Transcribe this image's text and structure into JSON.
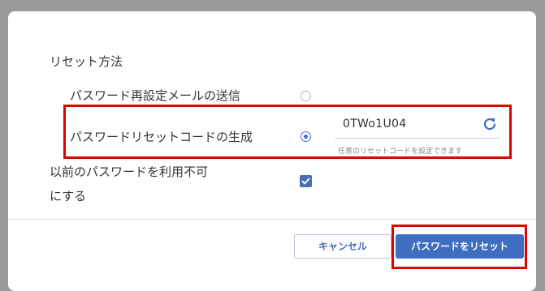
{
  "dialog": {
    "section_title": "リセット方法",
    "options": [
      {
        "label": "パスワード再設定メールの送信",
        "selected": false
      },
      {
        "label": "パスワードリセットコードの生成",
        "selected": true
      }
    ],
    "reset_code": {
      "value": "0TWo1U04",
      "hint": "任意のリセットコードを設定できます",
      "refresh_icon": "refresh-icon"
    },
    "disallow_previous": {
      "label_line1": "以前のパスワードを利用不可",
      "label_line2": "にする",
      "checked": true
    },
    "buttons": {
      "cancel": "キャンセル",
      "reset": "パスワードをリセット"
    }
  },
  "colors": {
    "accent": "#3f6ec0",
    "highlight": "#e00000",
    "backdrop": "#9a9a9a"
  }
}
